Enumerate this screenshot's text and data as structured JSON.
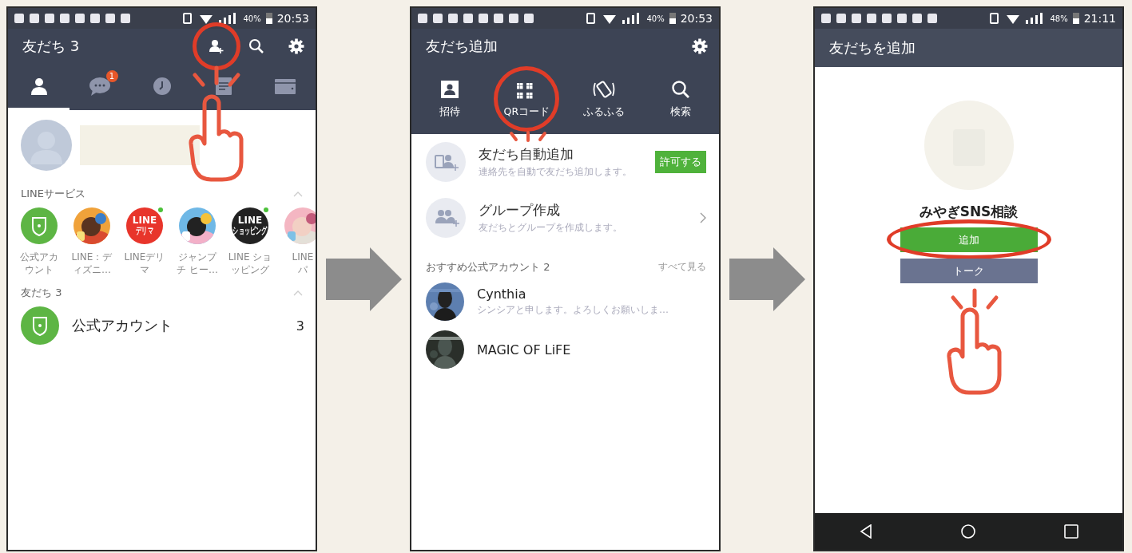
{
  "steps": [
    {
      "kind": "friends",
      "status_bar": {
        "battery": "40%",
        "time": "20:53"
      },
      "title": "友だち 3",
      "actions": [
        {
          "kind": "add_friend",
          "highlighted": true
        },
        {
          "kind": "search",
          "highlighted": false
        },
        {
          "kind": "settings",
          "highlighted": false
        }
      ],
      "tabs": [
        {
          "kind": "person",
          "selected": true
        },
        {
          "kind": "chat",
          "selected": false,
          "badge": "1"
        },
        {
          "kind": "clock",
          "selected": false
        },
        {
          "kind": "news",
          "selected": false
        },
        {
          "kind": "wallet",
          "selected": false
        }
      ],
      "sections": [
        {
          "kind": "services",
          "title": "LINEサービス",
          "expanded": true,
          "items": [
            {
              "kind": "shield",
              "lines": [
                "公式アカ",
                "ウント"
              ],
              "new": false
            },
            {
              "kind": "picture",
              "lines": [
                "LINE：デ",
                "ィズニ…"
              ],
              "new": false
            },
            {
              "kind": "logo",
              "color": "#e8352b",
              "logo": [
                "LINE",
                "デリマ"
              ],
              "lines": [
                "LINEデリ",
                "マ"
              ],
              "new": true
            },
            {
              "kind": "picture",
              "lines": [
                "ジャンプ",
                "チ ヒー…"
              ],
              "new": false
            },
            {
              "kind": "logo",
              "color": "#222222",
              "logo": [
                "LINE",
                "ショッピング"
              ],
              "lines": [
                "LINE ショ",
                "ッピング"
              ],
              "new": true
            },
            {
              "kind": "picture",
              "lines": [
                "LINE",
                "パ"
              ],
              "new": false
            }
          ]
        },
        {
          "kind": "friends",
          "title": "友だち 3",
          "expanded": true,
          "items": [
            {
              "name": "公式アカウント",
              "count": "3"
            }
          ]
        }
      ]
    },
    {
      "kind": "add_friend",
      "status_bar": {
        "battery": "40%",
        "time": "20:53"
      },
      "title": "友だち追加",
      "tools": [
        {
          "kind": "invite",
          "label": "招待",
          "highlighted": false
        },
        {
          "kind": "qr",
          "label": "QRコード",
          "highlighted": true
        },
        {
          "kind": "shake",
          "label": "ふるふる",
          "highlighted": false
        },
        {
          "kind": "search",
          "label": "検索",
          "highlighted": false
        }
      ],
      "options": [
        {
          "kind": "auto_add",
          "title": "友だち自動追加",
          "subtitle": "連絡先を自動で友だち追加します。",
          "action": "許可する"
        },
        {
          "kind": "group",
          "title": "グループ作成",
          "subtitle": "友だちとグループを作成します。"
        }
      ],
      "recommended": {
        "title": "おすすめ公式アカウント 2",
        "see_all": "すべて見る",
        "accounts": [
          {
            "name": "Cynthia",
            "message": "シンシアと申します。よろしくお願いしま…"
          },
          {
            "name": "MAGIC OF LiFE"
          }
        ]
      }
    },
    {
      "kind": "profile",
      "status_bar": {
        "battery": "48%",
        "time": "21:11"
      },
      "title": "友だちを追加",
      "name": "みやぎSNS相談",
      "buttons": [
        {
          "kind": "primary",
          "label": "追加",
          "highlighted": true
        },
        {
          "kind": "secondary",
          "label": "トーク",
          "highlighted": false
        }
      ]
    }
  ]
}
